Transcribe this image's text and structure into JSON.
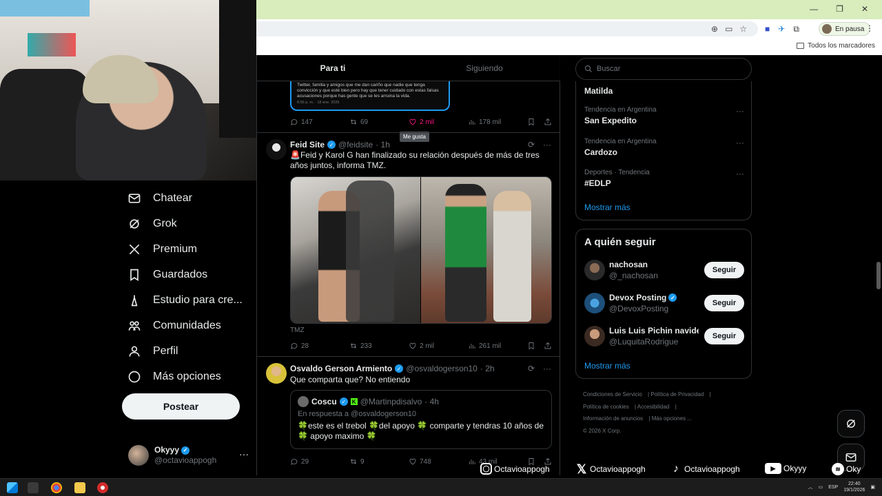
{
  "browser": {
    "pause_label": "En pausa",
    "bookmarks_all": "Todos los marcadores"
  },
  "nav": {
    "items": [
      {
        "label": "Chatear",
        "icon": "mail-icon"
      },
      {
        "label": "Grok",
        "icon": "grok-icon"
      },
      {
        "label": "Premium",
        "icon": "x-logo-icon"
      },
      {
        "label": "Guardados",
        "icon": "bookmark-icon"
      },
      {
        "label": "Estudio para cre...",
        "icon": "creator-studio-icon"
      },
      {
        "label": "Comunidades",
        "icon": "communities-icon"
      },
      {
        "label": "Perfil",
        "icon": "profile-icon"
      },
      {
        "label": "Más opciones",
        "icon": "more-circle-icon"
      }
    ],
    "post_button": "Postear",
    "profile": {
      "name": "Okyyy",
      "handle": "@octavioappogh"
    }
  },
  "timeline": {
    "tabs": [
      {
        "label": "Para ti",
        "active": true
      },
      {
        "label": "Siguiendo",
        "active": false
      }
    ],
    "prev_card": {
      "text": "Twitter, familia y amigos que me dan cariño que nadie que tenga convicción y que esté bien pero hay que tener cuidado con estas falsas acusaciones porque has gente que se les arruina la vida.",
      "timestamp": "8:56 p. m. · 18 ene. 2026"
    },
    "prev_actions": {
      "replies": "147",
      "reposts": "69",
      "likes": "2 mil",
      "views": "178 mil"
    },
    "tooltip": "Me gusta",
    "posts": [
      {
        "name": "Feid Site",
        "handle": "@feidsite",
        "time": "· 1h",
        "text": "🚨Feid y Karol G han finalizado su relación después de más de tres años juntos, informa TMZ.",
        "media_source": "TMZ",
        "replies": "28",
        "reposts": "233",
        "likes": "2 mil",
        "views": "261 mil"
      },
      {
        "name": "Osvaldo Gerson Armiento",
        "handle": "@osvaldogerson10",
        "time": "· 2h",
        "text": "Que comparta que? No entiendo",
        "quote": {
          "name": "Coscu",
          "handle": "@Martinpdisalvo",
          "time": "· 4h",
          "reply_to": "En respuesta a @osvaldogerson10",
          "text": "🍀este es el trebol 🍀del apoyo 🍀 comparte y tendras 10 años de 🍀 apoyo maximo 🍀"
        },
        "replies": "29",
        "reposts": "9",
        "likes": "748",
        "views": "43 mil"
      }
    ]
  },
  "sidebar_right": {
    "search_placeholder": "Buscar",
    "trends": [
      {
        "meta": "",
        "topic": "Matilda"
      },
      {
        "meta": "Tendencia en Argentina",
        "topic": "San Expedito"
      },
      {
        "meta": "Tendencia en Argentina",
        "topic": "Cardozo"
      },
      {
        "meta": "Deportes · Tendencia",
        "topic": "#EDLP"
      }
    ],
    "show_more": "Mostrar más",
    "who_to_follow": {
      "title": "A quién seguir",
      "users": [
        {
          "name": "nachosan",
          "handle": "@_nachosan",
          "verified": false
        },
        {
          "name": "Devox Posting",
          "handle": "@DevoxPosting",
          "verified": true
        },
        {
          "name": "Luis Luis Pichin navide...",
          "handle": "@LuquitaRodrigue",
          "verified": false
        }
      ],
      "follow_label": "Seguir",
      "show_more": "Mostrar más"
    },
    "footer": {
      "links": [
        "Condiciones de Servicio",
        "Política de Privacidad",
        "Política de cookies",
        "Accesibilidad",
        "Información de anuncios",
        "Más opciones ..."
      ],
      "copyright": "© 2026 X Corp."
    }
  },
  "social": [
    {
      "platform": "instagram-icon",
      "handle": "Octavioappogh"
    },
    {
      "platform": "x-logo-icon",
      "handle": "Octavioappogh"
    },
    {
      "platform": "tiktok-icon",
      "handle": "Octavioappogh"
    },
    {
      "platform": "youtube-icon",
      "handle": "Okyyy"
    },
    {
      "platform": "spotify-icon",
      "handle": "Oky"
    }
  ],
  "taskbar": {
    "lang": "ESP",
    "time": "22:40",
    "date": "19/1/2026"
  },
  "colors": {
    "accent": "#1d9bf0",
    "like": "#f91880",
    "background": "#000000",
    "chrome": "#d8ecbc"
  }
}
